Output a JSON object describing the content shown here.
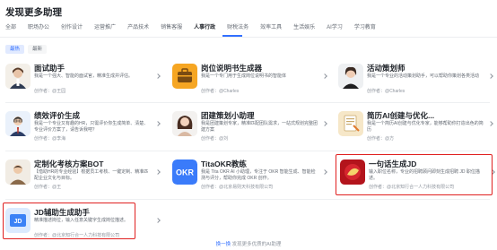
{
  "page": {
    "title": "发现更多助理"
  },
  "tabs": [
    {
      "label": "全部"
    },
    {
      "label": "职场办公"
    },
    {
      "label": "创作设计"
    },
    {
      "label": "运营推广"
    },
    {
      "label": "产品技术"
    },
    {
      "label": "销售客服"
    },
    {
      "label": "人事行政",
      "active": true
    },
    {
      "label": "财税法务"
    },
    {
      "label": "效率工具"
    },
    {
      "label": "生活娱乐"
    },
    {
      "label": "AI学习"
    },
    {
      "label": "学习教育"
    }
  ],
  "filters": [
    {
      "label": "最热",
      "active": true
    },
    {
      "label": "最新",
      "active": false
    }
  ],
  "cards": [
    {
      "name": "面试助手",
      "desc": "我是一个强大、智能的面试官，精准生成并评估。",
      "author": "创作者：@王园"
    },
    {
      "name": "岗位说明书生成器",
      "desc": "我是一个专门用于生成岗位说明书的智能体",
      "author": "创作者：@Charles"
    },
    {
      "name": "活动策划师",
      "desc": "我是一个专业的活动策划助手，可以帮助你策划各类活动",
      "author": "创作者：@Charles"
    },
    {
      "name": "绩效评价生成",
      "desc": "我是一个专业又有趣的HR，只需评价你生成简单、清楚、专业评价方案了，请告诉我吧？",
      "author": "创作者：@李海"
    },
    {
      "name": "团建策划小助理",
      "desc": "我是团建策划专家，精准匹配团队需求，一站式规划完整团建方案",
      "author": "创作者：@刘"
    },
    {
      "name": "简历AI创建与优化...",
      "desc": "我是一个简历AI创建与优化专家，能够帮助你打造出色的简历",
      "author": "创作者：@方"
    },
    {
      "name": "定制化考核方案BOT",
      "desc": "【借助HR的专业经验】根据员工考核、一键定制、精准匹配企业文化与目标。",
      "author": "创作者：@王"
    },
    {
      "name": "TitaOKR教练",
      "desc": "我是 Tita OKR AI 小助理，专注于 OKR 智能生成、智能检测与评分，帮助你完成 OKR 创作。",
      "author": "创作者：@北京易则天科技有限公司"
    },
    {
      "name": "一句话生成JD",
      "desc": "输入职位名称，专业的招聘顾问即刻生成招聘 JD 职位描述。",
      "author": "创作者：@北京知行合一人力科技有限公司"
    },
    {
      "name": "JD辅助生成助手",
      "desc": "精准描述岗位，输入任意关键字生成岗位描述。",
      "author": "创作者：@北京知行合一人力科技有限公司"
    }
  ],
  "footer": {
    "link": "换一换",
    "rest": "  发现更多优质的AI助理"
  },
  "colors": {
    "accent": "#3370ff",
    "highlight": "#e02020"
  }
}
